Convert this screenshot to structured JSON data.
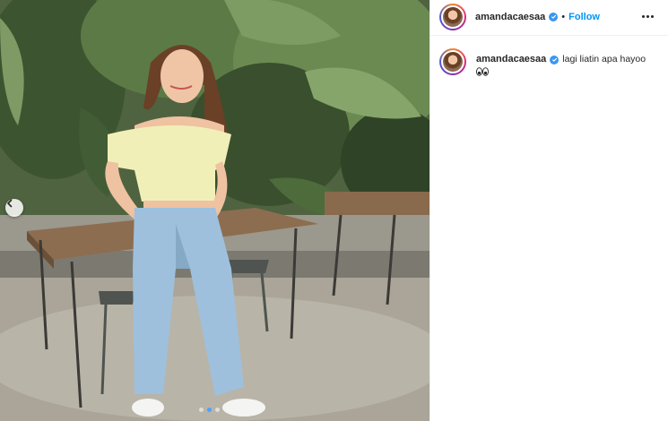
{
  "post": {
    "username": "amandacaesaa",
    "verified": true,
    "header_separator": "•",
    "follow_label": "Follow",
    "more_icon": "more-options-icon",
    "caption": {
      "username": "amandacaesaa",
      "text": "lagi liatin apa hayoo",
      "emoji": "eyes-emoji"
    }
  },
  "carousel": {
    "total_slides": 3,
    "active_index": 1,
    "prev_icon": "chevron-left-icon"
  },
  "colors": {
    "follow_blue": "#0095f6",
    "verified_blue": "#3897f0",
    "active_dot": "#4aa3ff"
  }
}
